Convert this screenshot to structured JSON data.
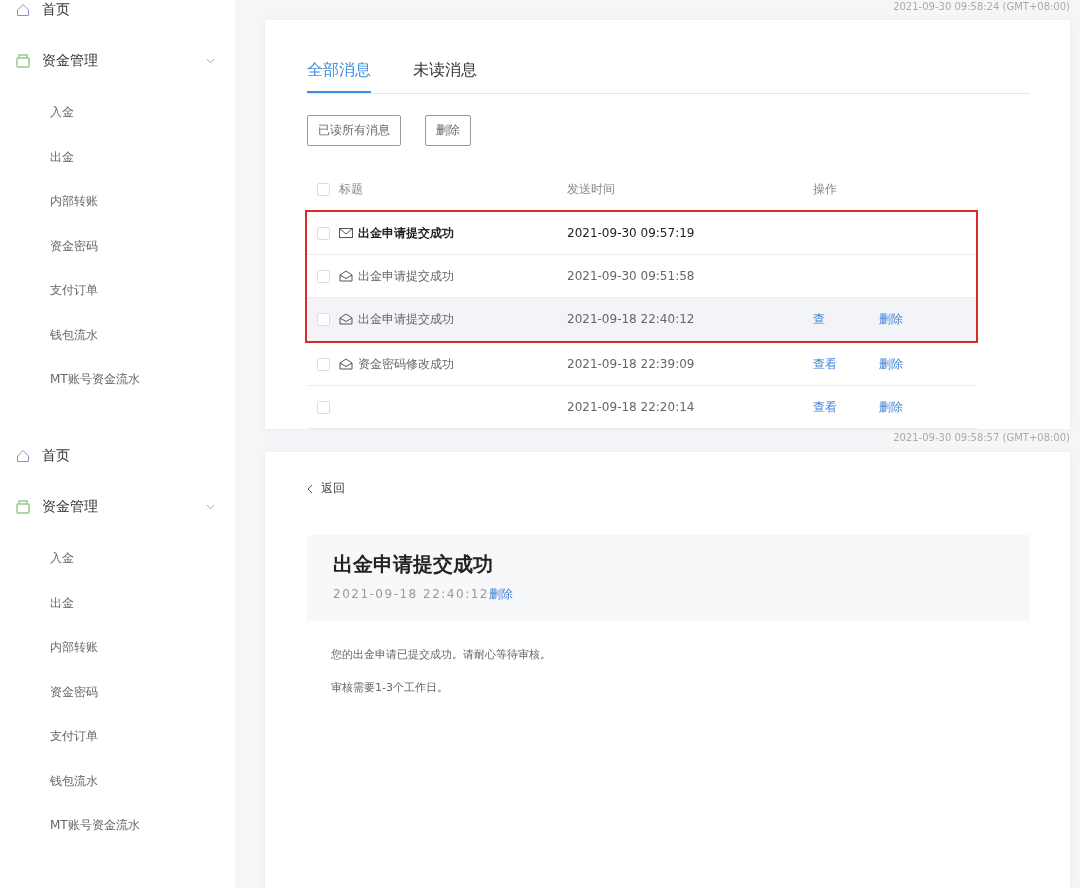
{
  "screens": [
    {
      "sidebar": {
        "items": [
          {
            "kind": "link",
            "label": "首页"
          },
          {
            "kind": "group",
            "label": "资金管理",
            "expanded": true,
            "children": [
              {
                "label": "入金"
              },
              {
                "label": "出金"
              },
              {
                "label": "内部转账"
              },
              {
                "label": "资金密码"
              },
              {
                "label": "支付订单"
              },
              {
                "label": "钱包流水"
              },
              {
                "label": "MT账号资金流水"
              }
            ]
          }
        ]
      },
      "timestamp_top": "2021-09-30 09:58:24 (GMT+08:00)",
      "timestamp_bottom": "2021-09-30 09:58:57 (GMT+08:00)",
      "messages": {
        "tabs": [
          {
            "label": "全部消息",
            "selected": true
          },
          {
            "label": "未读消息",
            "selected": false
          }
        ],
        "buttons": [
          "已读所有消息",
          "删除"
        ],
        "select_all_checked": false,
        "columns": [
          "标题",
          "发送时间",
          "操作"
        ],
        "rows": [
          {
            "title": "出金申请提交成功",
            "time": "2021-09-30 09:57:19",
            "unread": true,
            "highlighted": false,
            "boxed": true
          },
          {
            "title": "出金申请提交成功",
            "time": "2021-09-30 09:51:58",
            "unread": false,
            "highlighted": false,
            "boxed": true
          },
          {
            "title": "出金申请提交成功",
            "time": "2021-09-18 22:40:12",
            "unread": false,
            "highlighted": true,
            "boxed": true,
            "actions": [
              "查",
              "删除"
            ]
          },
          {
            "title": "资金密码修改成功",
            "time": "2021-09-18 22:39:09",
            "unread": false,
            "highlighted": false,
            "boxed": false,
            "actions": [
              "查看",
              "删除"
            ]
          },
          {
            "time": "2021-09-18 22:20:14",
            "unread": false,
            "highlighted": false,
            "boxed": false,
            "actions": [
              "查看",
              "删除"
            ]
          }
        ]
      }
    },
    {
      "sidebar": {
        "items": [
          {
            "kind": "link",
            "label": "首页"
          },
          {
            "kind": "group",
            "label": "资金管理",
            "expanded": true,
            "children": [
              {
                "label": "入金"
              },
              {
                "label": "出金"
              },
              {
                "label": "内部转账"
              },
              {
                "label": "资金密码"
              },
              {
                "label": "支付订单"
              },
              {
                "label": "钱包流水"
              },
              {
                "label": "MT账号资金流水"
              }
            ]
          }
        ]
      },
      "detail": {
        "back": "返回",
        "title": "出金申请提交成功",
        "time": "2021-09-18 22:40:12",
        "delete": "删除",
        "body": [
          "您的出金申请已提交成功。请耐心等待审核。",
          "审核需要1-3个工作日。"
        ]
      }
    }
  ]
}
